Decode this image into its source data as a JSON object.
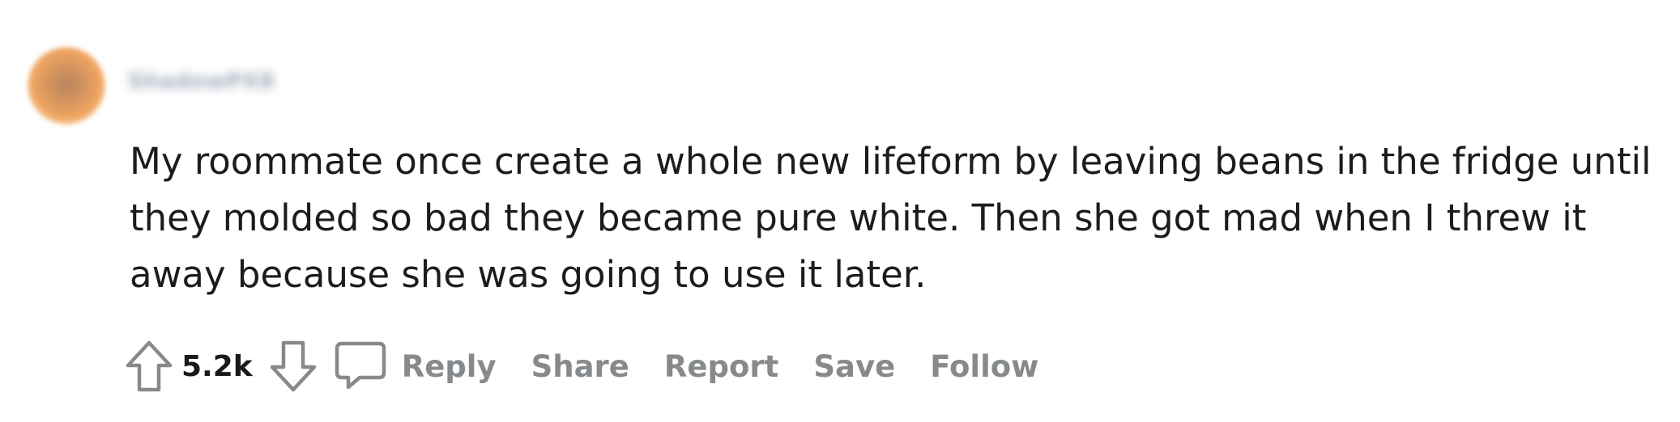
{
  "comment": {
    "author": "ShadowPX8",
    "body": "My roommate once create a whole new lifeform by leaving beans in the fridge until they molded so bad they became pure white. Then she got mad when I threw it away because she was going to use it later.",
    "score": "5.2k",
    "actions": {
      "reply": "Reply",
      "share": "Share",
      "report": "Report",
      "save": "Save",
      "follow": "Follow"
    }
  },
  "icons": {
    "upvote": "upvote-arrow-icon",
    "downvote": "downvote-arrow-icon",
    "reply": "speech-bubble-icon"
  },
  "colors": {
    "action_text": "#878a8c",
    "score_text": "#1a1a1b",
    "icon_stroke": "#878a8c",
    "avatar": "#e89a5c"
  }
}
